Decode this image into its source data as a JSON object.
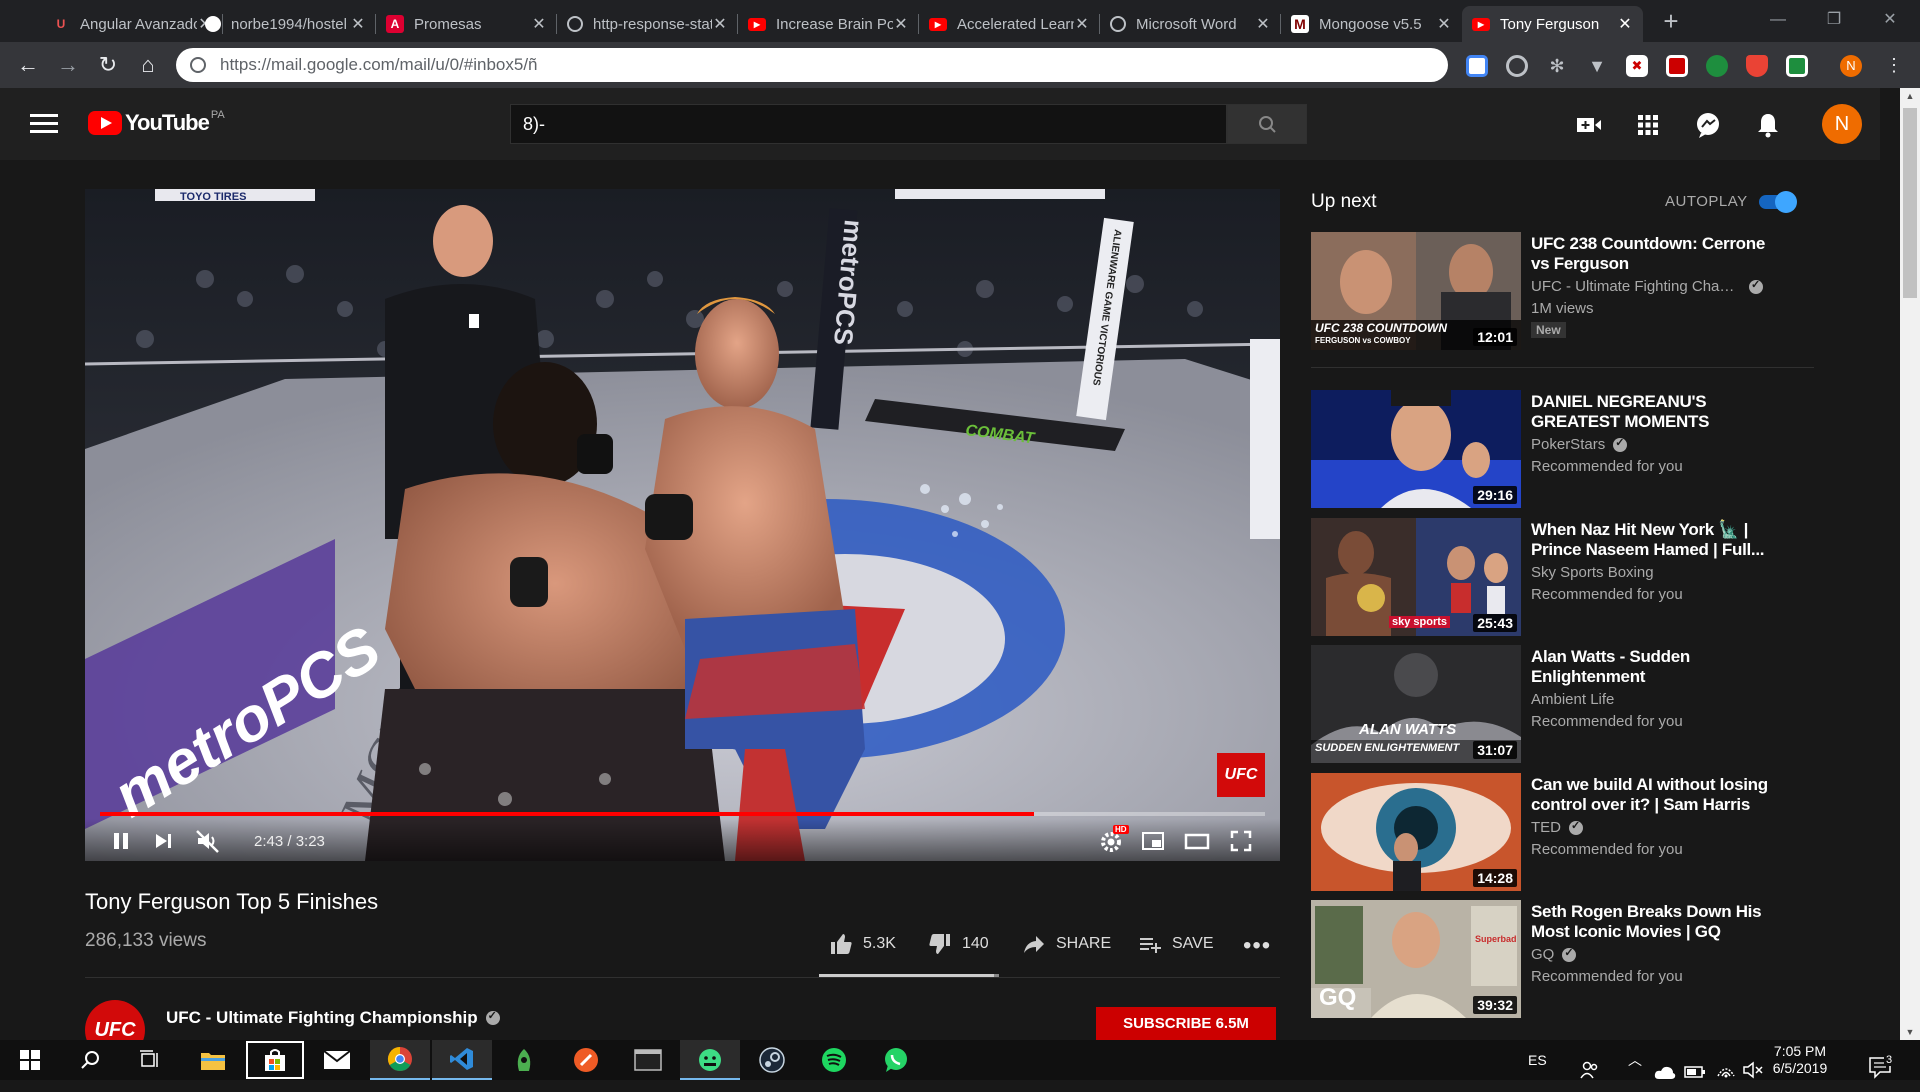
{
  "browser": {
    "tabs": [
      {
        "title": "Angular Avanzado",
        "favicon": "udemy-icon",
        "color": "#ec5252",
        "active": false
      },
      {
        "title": "norbe1994/hostel",
        "favicon": "github-icon",
        "color": "#ffffff",
        "active": false
      },
      {
        "title": "Promesas",
        "favicon": "angular-icon",
        "color": "#dd0031",
        "active": false
      },
      {
        "title": "http-response-status",
        "favicon": "globe-icon",
        "color": "#bdc1c6",
        "active": false
      },
      {
        "title": "Increase Brain Power",
        "favicon": "youtube-icon",
        "color": "#ff0000",
        "active": false
      },
      {
        "title": "Accelerated Learning",
        "favicon": "youtube-icon",
        "color": "#ff0000",
        "active": false
      },
      {
        "title": "Microsoft Word",
        "favicon": "globe-icon",
        "color": "#bdc1c6",
        "active": false
      },
      {
        "title": "Mongoose v5.5",
        "favicon": "mongoose-icon",
        "color": "#800000",
        "active": false
      },
      {
        "title": "Tony Ferguson",
        "favicon": "youtube-icon",
        "color": "#ff0000",
        "active": true
      }
    ],
    "new_tab_label": "+",
    "url": "https://mail.google.com/mail/u/0/#inbox5/ñ",
    "profile_initial": "N"
  },
  "youtube": {
    "logo_text": "YouTube",
    "region": "PA",
    "search_value": "8)-",
    "avatar_initial": "N"
  },
  "player": {
    "time_current": "2:43",
    "time_total": "3:23",
    "time_display": "2:43 / 3:23",
    "progress_fraction": 0.802,
    "buffered_fraction": 1.0,
    "watermark": "UFC",
    "hd_badge": "HD",
    "scene_text": {
      "sponsor_left": "metroPCS",
      "arena": "MGM GRAND",
      "sponsor_post": "metroPCS",
      "banner": "ALIENWARE GAME VICTORIOUS",
      "toyo": "TOYO TIRES",
      "combat": "COMBAT"
    }
  },
  "video": {
    "title": "Tony Ferguson Top 5 Finishes",
    "views": "286,133 views",
    "likes": "5.3K",
    "dislikes": "140",
    "like_fraction": 0.974,
    "share_label": "SHARE",
    "save_label": "SAVE",
    "channel": "UFC - Ultimate Fighting Championship",
    "channel_avatar_text": "UFC",
    "subscribe_label": "SUBSCRIBE 6.5M"
  },
  "sidebar": {
    "heading": "Up next",
    "autoplay_label": "AUTOPLAY",
    "autoplay_on": true,
    "items": [
      {
        "title": "UFC 238 Countdown: Cerrone vs Ferguson",
        "channel": "UFC - Ultimate Fighting Championship",
        "verified": true,
        "meta": "1M views",
        "badge": "New",
        "duration": "12:01",
        "thumb_text": "UFC 238 COUNTDOWN",
        "thumb_subtext": "FERGUSON vs COWBOY"
      },
      {
        "title": "DANIEL NEGREANU'S GREATEST MOMENTS",
        "channel": "PokerStars",
        "verified": true,
        "meta": "Recommended for you",
        "duration": "29:16"
      },
      {
        "title": "When Naz Hit New York 🗽 | Prince Naseem Hamed | Full...",
        "channel": "Sky Sports Boxing",
        "verified": false,
        "meta": "Recommended for you",
        "duration": "25:43",
        "thumb_text": "sky sports"
      },
      {
        "title": "Alan Watts - Sudden Enlightenment",
        "channel": "Ambient Life",
        "verified": false,
        "meta": "Recommended for you",
        "duration": "31:07",
        "thumb_text": "ALAN WATTS",
        "thumb_subtext": "SUDDEN ENLIGHTENMENT"
      },
      {
        "title": "Can we build AI without losing control over it? | Sam Harris",
        "channel": "TED",
        "verified": true,
        "meta": "Recommended for you",
        "duration": "14:28"
      },
      {
        "title": "Seth Rogen Breaks Down His Most Iconic Movies | GQ",
        "channel": "GQ",
        "verified": true,
        "meta": "Recommended for you",
        "duration": "39:32",
        "thumb_text": "GQ",
        "thumb_subtext": "Superbad"
      }
    ]
  },
  "taskbar": {
    "language": "ES",
    "time": "7:05 PM",
    "date": "6/5/2019",
    "notification_count": "3"
  }
}
